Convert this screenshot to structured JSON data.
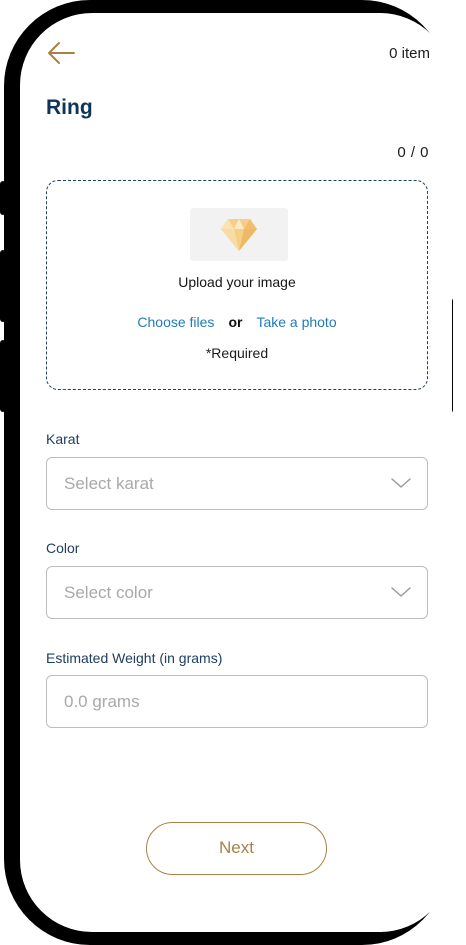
{
  "header": {
    "item_count": "0 item"
  },
  "page": {
    "title": "Ring",
    "counter": "0 / 0"
  },
  "upload": {
    "title": "Upload your  image",
    "choose_files": "Choose files",
    "or": "or",
    "take_photo": "Take a photo",
    "required": "*Required",
    "icon": "diamond-icon"
  },
  "fields": {
    "karat": {
      "label": "Karat",
      "placeholder": "Select karat"
    },
    "color": {
      "label": "Color",
      "placeholder": "Select color"
    },
    "weight": {
      "label": "Estimated Weight (in grams)",
      "placeholder": "0.0 grams"
    }
  },
  "actions": {
    "next_label": "Next"
  },
  "colors": {
    "accent_gold": "#a88245",
    "title_navy": "#0e3457",
    "link_blue": "#1f7cb8"
  }
}
